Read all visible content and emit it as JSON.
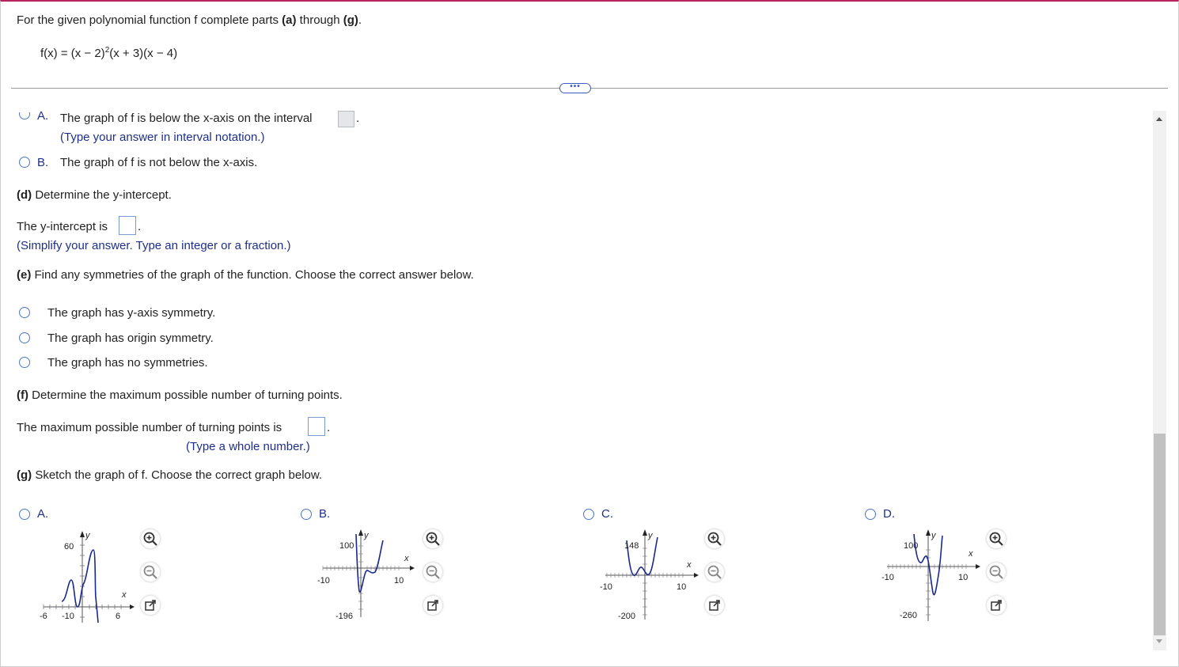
{
  "intro": {
    "text": "For the given polynomial function f complete parts ",
    "a": "(a)",
    "through": " through ",
    "g": "(g)",
    "end": "."
  },
  "function": {
    "prefix": "f(x) = (x − 2)",
    "exponent": "2",
    "suffix": "(x + 3)(x − 4)"
  },
  "part_c": {
    "optA_letter": "A.",
    "optA_text": "The graph of f is below the x-axis on the interval",
    "optA_hint": "(Type your answer in interval notation.)",
    "optB_letter": "B.",
    "optB_text": "The graph of f is not below the x-axis.",
    "period": "."
  },
  "part_d": {
    "label": "(d)",
    "heading": " Determine the y-intercept.",
    "text": "The y-intercept is",
    "period": ".",
    "hint": "(Simplify your answer. Type an integer or a fraction.)"
  },
  "part_e": {
    "label": "(e)",
    "heading": " Find any symmetries of the graph of the function. Choose the correct answer below.",
    "options": [
      "The graph has y-axis symmetry.",
      "The graph has origin symmetry.",
      "The graph has no symmetries."
    ]
  },
  "part_f": {
    "label": "(f)",
    "heading": " Determine the maximum possible number of turning points.",
    "text": "The maximum possible number of turning points is",
    "period": ".",
    "hint": "(Type a whole number.)"
  },
  "part_g": {
    "label": "(g)",
    "heading": " Sketch the graph of f. Choose the correct graph below.",
    "graphs": [
      {
        "letter": "A.",
        "ymax": "60",
        "ymin": "-10",
        "xmin": "-6",
        "xmax": "6",
        "xlabel": "x",
        "ylabel": "y"
      },
      {
        "letter": "B.",
        "ymax": "100",
        "ymin": "-196",
        "xmin": "-10",
        "xmax": "10",
        "xlabel": "x",
        "ylabel": "y"
      },
      {
        "letter": "C.",
        "ymax": "148",
        "ymin": "-200",
        "xmin": "-10",
        "xmax": "10",
        "xlabel": "x",
        "ylabel": "y"
      },
      {
        "letter": "D.",
        "ymax": "100",
        "ymin": "-260",
        "xmin": "-10",
        "xmax": "10",
        "xlabel": "x",
        "ylabel": "y"
      }
    ]
  },
  "icons": {
    "expand": "ellipsis-icon",
    "zoom_in": "zoom-in-icon",
    "zoom_out": "zoom-out-icon",
    "popout": "external-link-icon"
  },
  "colors": {
    "accent": "#1e2f8a",
    "radio": "#4a77c9",
    "curve": "#1a2a8c",
    "top_border": "#b5245f"
  }
}
